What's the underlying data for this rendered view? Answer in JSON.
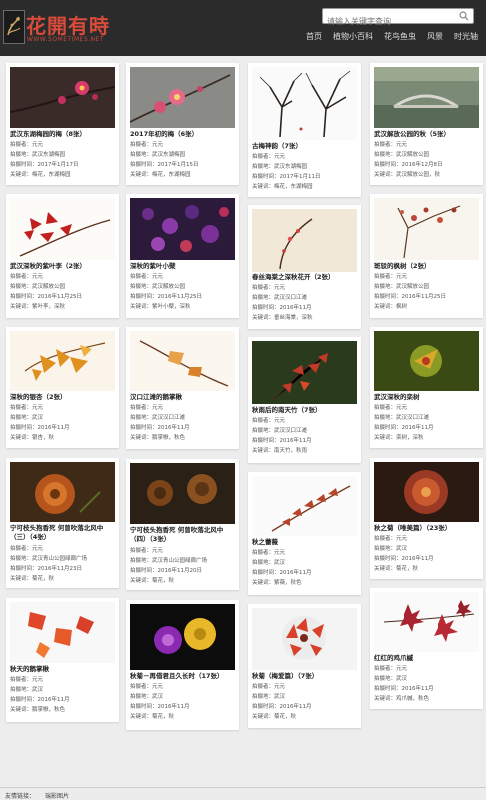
{
  "site": {
    "name": "花開有時",
    "url": "WWW.SOMETIMES.NET"
  },
  "search": {
    "placeholder": "请输入关键字查询"
  },
  "nav": [
    "首页",
    "植物小百科",
    "花鸟鱼虫",
    "风景",
    "时光轴"
  ],
  "labels": {
    "photographer": "拍摄者：",
    "place": "拍摄地：",
    "time": "拍摄时间：",
    "keywords": "关键词："
  },
  "columns": [
    [
      {
        "title": "武汉东湖梅园的梅（8张）",
        "author": "元元",
        "place": "武汉东湖梅园",
        "time": "2017年1月17日",
        "keywords": "梅花，东湖梅园"
      },
      {
        "title": "武汉深秋的紫叶李（2张）",
        "author": "元元",
        "place": "武汉解放公园",
        "time": "2016年11月25日",
        "keywords": "紫叶李，深秋"
      },
      {
        "title": "深秋的银杏（2张）",
        "author": "元元",
        "place": "武汉",
        "time": "2016年11月",
        "keywords": "银杏，秋"
      },
      {
        "title": "宁可枝头抱香死 何曾吹落北风中（三）（4张）",
        "author": "元元",
        "place": "武汉青山公园绿廊广场",
        "time": "2016年11月23日",
        "keywords": "菊花，秋"
      },
      {
        "title": "秋天的鹅掌楸",
        "author": "元元",
        "place": "武汉",
        "time": "2016年11月",
        "keywords": "鹅掌楸，秋色"
      }
    ],
    [
      {
        "title": "2017年初的梅（6张）",
        "author": "元元",
        "place": "武汉东湖梅园",
        "time": "2017年1月15日",
        "keywords": "梅花，东湖梅园"
      },
      {
        "title": "深秋的紫叶小檗",
        "author": "元元",
        "place": "武汉解放公园",
        "time": "2016年11月25日",
        "keywords": "紫叶小檗，深秋"
      },
      {
        "title": "汉口江滩的鹅掌楸",
        "author": "元元",
        "place": "武汉汉口江滩",
        "time": "2016年11月",
        "keywords": "鹅掌楸，秋色"
      },
      {
        "title": "宁可枝头抱香死 何曾吹落北风中（四）（3张）",
        "author": "元元",
        "place": "武汉青山公园绿廊广场",
        "time": "2016年11月20日",
        "keywords": "菊花，秋"
      },
      {
        "title": "秋菊－再借君且久长时（17张）",
        "author": "元元",
        "place": "武汉",
        "time": "2016年11月",
        "keywords": "菊花，秋"
      }
    ],
    [
      {
        "title": "古梅神韵（7张）",
        "author": "元元",
        "place": "武汉东湖梅园",
        "time": "2017年1月11日",
        "keywords": "梅花，东湖梅园"
      },
      {
        "title": "春丝海棠之深秋花开（2张）",
        "author": "元元",
        "place": "武汉汉口江滩",
        "time": "2016年11月",
        "keywords": "垂丝海棠，深秋"
      },
      {
        "title": "秋雨后的南天竹（7张）",
        "author": "元元",
        "place": "武汉汉口江滩",
        "time": "2016年11月",
        "keywords": "南天竹，秋雨"
      },
      {
        "title": "秋之蕾薇",
        "author": "元元",
        "place": "武汉",
        "time": "2016年11月",
        "keywords": "紫薇，秋色"
      },
      {
        "title": "秋菊（梅爱篇）（7张）",
        "author": "元元",
        "place": "武汉",
        "time": "2016年11月",
        "keywords": "菊花，秋"
      }
    ],
    [
      {
        "title": "武汉解放公园的秋（5张）",
        "author": "元元",
        "place": "武汉解放公园",
        "time": "2016年12月8日",
        "keywords": "武汉解放公园，秋"
      },
      {
        "title": "斑驳的枫树（2张）",
        "author": "元元",
        "place": "武汉解放公园",
        "time": "2016年11月25日",
        "keywords": "枫树"
      },
      {
        "title": "武汉深秋的栾树",
        "author": "元元",
        "place": "武汉汉口江滩",
        "time": "2016年11月",
        "keywords": "栾树，深秋"
      },
      {
        "title": "秋之菊（唯美篇）（23张）",
        "author": "元元",
        "place": "武汉",
        "time": "2016年11月",
        "keywords": "菊花，秋"
      },
      {
        "title": "红红的鸡爪槭",
        "author": "元元",
        "place": "武汉",
        "time": "2016年11月",
        "keywords": "鸡爪槭，秋色"
      }
    ]
  ],
  "footer": {
    "label": "友情链接：",
    "links": [
      "瑞影图片"
    ]
  }
}
